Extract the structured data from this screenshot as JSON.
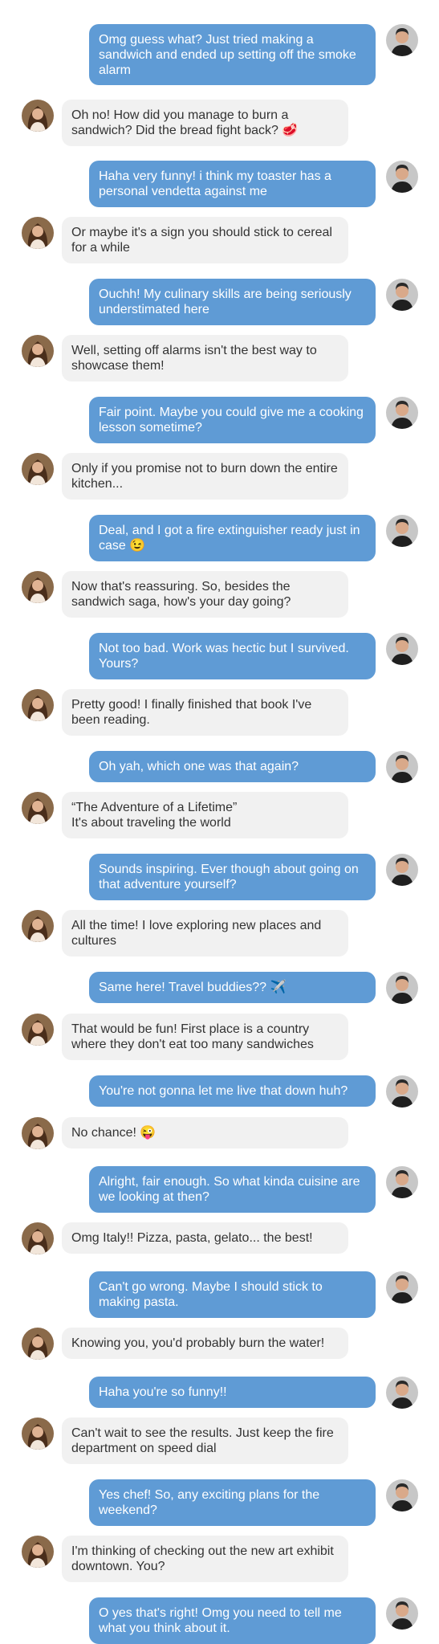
{
  "messages": [
    {
      "from": "me",
      "text": "Omg guess what? Just tried making a sandwich and ended up setting off the smoke alarm"
    },
    {
      "from": "them",
      "text": "Oh no! How did you manage to burn a sandwich? Did the bread fight back? 🥩"
    },
    {
      "from": "me",
      "text": "Haha very funny! i think my toaster has a personal vendetta against me"
    },
    {
      "from": "them",
      "text": "Or maybe it's a sign you should stick to cereal for a while"
    },
    {
      "from": "me",
      "text": "Ouchh! My culinary skills are being seriously understimated here"
    },
    {
      "from": "them",
      "text": "Well, setting off alarms isn't the best way to showcase them!"
    },
    {
      "from": "me",
      "text": "Fair point. Maybe you could give me a cooking lesson sometime?"
    },
    {
      "from": "them",
      "text": "Only if you promise not to burn down the entire kitchen..."
    },
    {
      "from": "me",
      "text": "Deal, and I got a fire extinguisher ready just in case 😉"
    },
    {
      "from": "them",
      "text": "Now that's reassuring. So, besides the sandwich saga, how's your day going?"
    },
    {
      "from": "me",
      "text": "Not too bad. Work was hectic but I survived. Yours?"
    },
    {
      "from": "them",
      "text": "Pretty good! I finally finished that book I've been reading."
    },
    {
      "from": "me",
      "text": "Oh yah, which one was that again?"
    },
    {
      "from": "them",
      "text": "“The Adventure of a Lifetime”\nIt's about traveling the world"
    },
    {
      "from": "me",
      "text": "Sounds inspiring. Ever though about going on that adventure yourself?"
    },
    {
      "from": "them",
      "text": "All the time! I love exploring new places and cultures"
    },
    {
      "from": "me",
      "text": "Same here! Travel buddies?? ✈️"
    },
    {
      "from": "them",
      "text": "That would be fun! First place is a country where they don't eat too many sandwiches"
    },
    {
      "from": "me",
      "text": "You're not gonna let me live that down huh?"
    },
    {
      "from": "them",
      "text": "No chance! 😜"
    },
    {
      "from": "me",
      "text": "Alright, fair enough. So what kinda cuisine are we looking at then?"
    },
    {
      "from": "them",
      "text": "Omg Italy!! Pizza, pasta, gelato... the best!"
    },
    {
      "from": "me",
      "text": "Can't go wrong. Maybe I should stick to making pasta."
    },
    {
      "from": "them",
      "text": "Knowing you, you'd probably burn the water!"
    },
    {
      "from": "me",
      "text": "Haha you're so funny!!"
    },
    {
      "from": "them",
      "text": "Can't wait to see the results. Just keep the fire department on speed dial"
    },
    {
      "from": "me",
      "text": "Yes chef! So, any exciting plans for the weekend?"
    },
    {
      "from": "them",
      "text": "I'm thinking of checking out the new art exhibit downtown. You?"
    },
    {
      "from": "me",
      "text": "O yes that's right! Omg you need to tell me what you think about it."
    }
  ],
  "colors": {
    "me_bubble": "#5f9bd5",
    "them_bubble": "#f1f1f1",
    "me_text": "#ffffff",
    "them_text": "#333333"
  },
  "avatars": {
    "me": "male-avatar-icon",
    "them": "female-avatar-icon"
  }
}
